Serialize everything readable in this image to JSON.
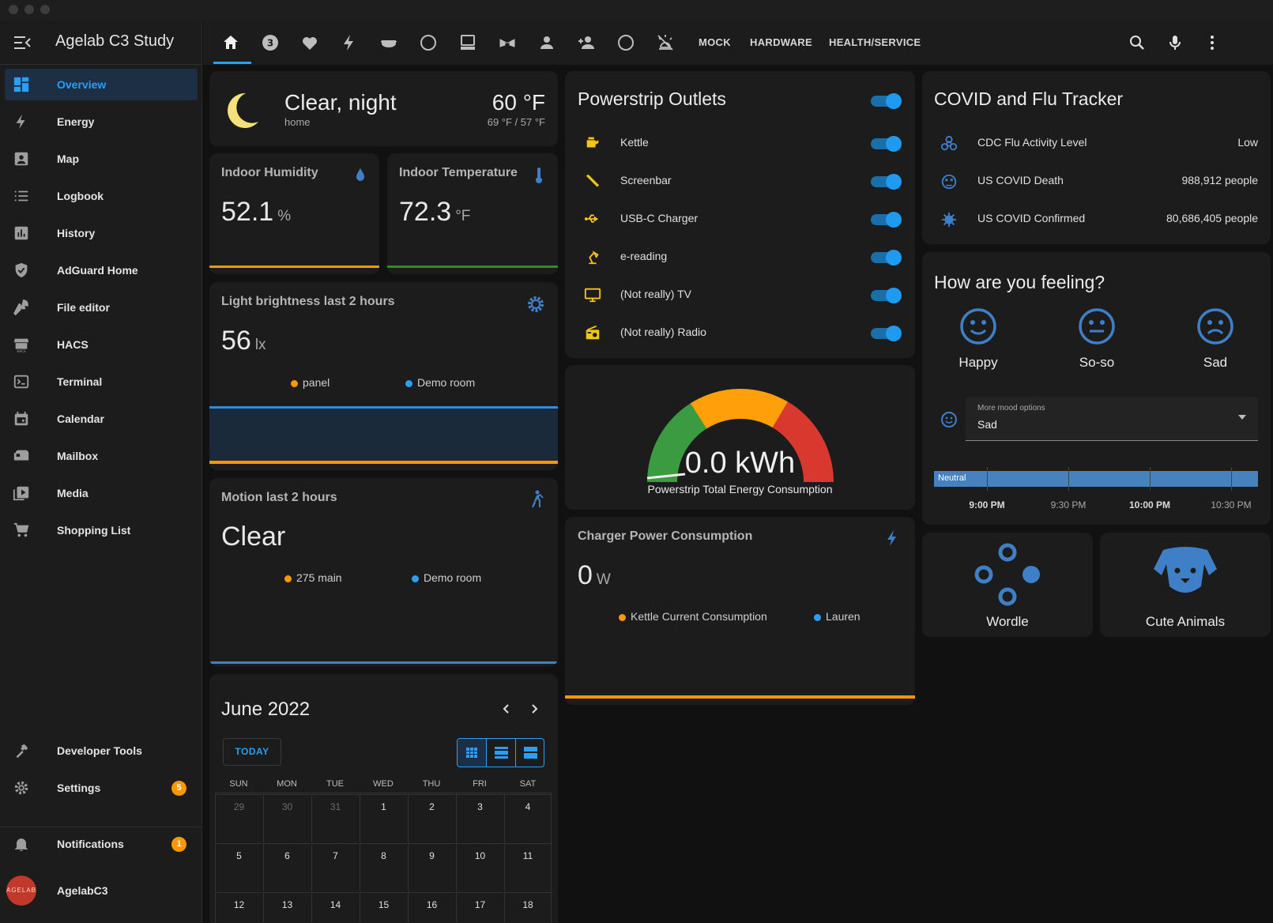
{
  "app": {
    "title": "Agelab C3 Study"
  },
  "sidebar": {
    "items": [
      {
        "label": "Overview",
        "icon": "dashboard-icon",
        "active": true
      },
      {
        "label": "Energy",
        "icon": "lightning-icon"
      },
      {
        "label": "Map",
        "icon": "map-person-icon"
      },
      {
        "label": "Logbook",
        "icon": "list-icon"
      },
      {
        "label": "History",
        "icon": "chart-box-icon"
      },
      {
        "label": "AdGuard Home",
        "icon": "shield-check-icon"
      },
      {
        "label": "File editor",
        "icon": "wrench-icon"
      },
      {
        "label": "HACS",
        "icon": "hacs-store-icon"
      },
      {
        "label": "Terminal",
        "icon": "console-icon"
      },
      {
        "label": "Calendar",
        "icon": "calendar-icon"
      },
      {
        "label": "Mailbox",
        "icon": "mailbox-icon"
      },
      {
        "label": "Media",
        "icon": "play-box-icon"
      },
      {
        "label": "Shopping List",
        "icon": "cart-icon"
      }
    ],
    "developer_tools": "Developer Tools",
    "settings": "Settings",
    "settings_badge": "5",
    "notifications": "Notifications",
    "notifications_badge": "1",
    "user": "AgelabC3",
    "avatar_text": "AGELAB"
  },
  "toolbar": {
    "tab_badge": "3",
    "text_tabs": [
      "MOCK",
      "HARDWARE",
      "HEALTH/SERVICE"
    ]
  },
  "weather": {
    "condition": "Clear, night",
    "location": "home",
    "temp": "60 °F",
    "range": "69 °F / 57 °F"
  },
  "humidity": {
    "title": "Indoor Humidity",
    "value": "52.1",
    "unit": "%"
  },
  "temperature": {
    "title": "Indoor Temperature",
    "value": "72.3",
    "unit": "°F"
  },
  "brightness": {
    "title": "Light brightness last 2 hours",
    "value": "56",
    "unit": "lx",
    "legend": [
      "panel",
      "Demo room"
    ]
  },
  "motion": {
    "title": "Motion last 2 hours",
    "value": "Clear",
    "legend": [
      "275 main",
      "Demo room"
    ]
  },
  "calendar": {
    "title": "June 2022",
    "today": "TODAY",
    "days": [
      "SUN",
      "MON",
      "TUE",
      "WED",
      "THU",
      "FRI",
      "SAT"
    ],
    "weeks": [
      [
        "29",
        "30",
        "31",
        "1",
        "2",
        "3",
        "4"
      ],
      [
        "5",
        "6",
        "7",
        "8",
        "9",
        "10",
        "11"
      ],
      [
        "12",
        "13",
        "14",
        "15",
        "16",
        "17",
        "18"
      ]
    ]
  },
  "powerstrip": {
    "title": "Powerstrip Outlets",
    "outlets": [
      {
        "label": "Kettle",
        "icon": "kettle-icon"
      },
      {
        "label": "Screenbar",
        "icon": "lamp-bar-icon"
      },
      {
        "label": "USB-C Charger",
        "icon": "usb-icon"
      },
      {
        "label": "e-reading",
        "icon": "desk-lamp-icon"
      },
      {
        "label": "(Not really) TV",
        "icon": "monitor-icon"
      },
      {
        "label": "(Not really) Radio",
        "icon": "radio-icon"
      }
    ]
  },
  "gauge": {
    "value": "0.0 kWh",
    "label": "Powerstrip Total Energy Consumption",
    "colors": [
      "#3a9b40",
      "#ff9f0a",
      "#d9382f"
    ]
  },
  "charger": {
    "title": "Charger Power Consumption",
    "value": "0",
    "unit": "W",
    "legend": [
      "Kettle Current Consumption",
      "Lauren"
    ]
  },
  "covid": {
    "title": "COVID and Flu Tracker",
    "rows": [
      {
        "label": "CDC Flu Activity Level",
        "value": "Low",
        "icon": "biohazard-icon"
      },
      {
        "label": "US COVID Death",
        "value": "988,912 people",
        "icon": "emoticon-dead-icon"
      },
      {
        "label": "US COVID Confirmed",
        "value": "80,686,405 people",
        "icon": "virus-icon"
      }
    ]
  },
  "mood": {
    "title": "How are you feeling?",
    "options": [
      "Happy",
      "So-so",
      "Sad"
    ],
    "select_label": "More mood options",
    "select_value": "Sad",
    "timeline_state": "Neutral",
    "times": [
      "9:00 PM",
      "9:30 PM",
      "10:00 PM",
      "10:30 PM"
    ]
  },
  "tiles": {
    "wordle": "Wordle",
    "animals": "Cute Animals"
  },
  "colors": {
    "accent": "#2a9ff5",
    "orange": "#ff9800",
    "green": "#2e8b2e",
    "card": "#1c1c1c",
    "bg": "#111111"
  }
}
